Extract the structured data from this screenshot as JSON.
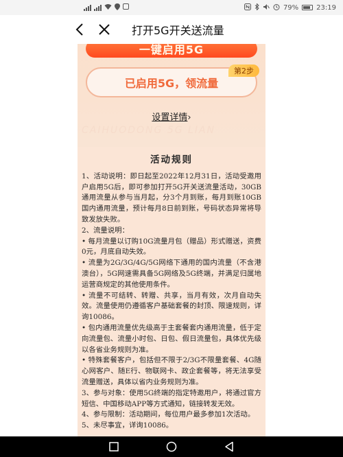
{
  "status_bar": {
    "left_icons": [
      "sim1-signal-icon",
      "sim2-signal-icon",
      "wifi-icon",
      "location-icon",
      "misc-icon"
    ],
    "right_icons": [
      "nfc-icon",
      "bluetooth-icon",
      "mute-icon",
      "alarm-icon"
    ],
    "battery": "79%",
    "time": "23:19"
  },
  "header": {
    "title": "打开5G开关送流量"
  },
  "promo": {
    "enable_label": "一键启用5G",
    "enabled_label": "已启用5G，领流量",
    "step_badge": "第2步",
    "settings_link": "设置详情",
    "settings_arrow": "›",
    "watermark": "CAIHUODONG 5G LIAN"
  },
  "rules": {
    "title": "活动规则",
    "paragraphs": [
      "1、活动说明：即日起至2022年12月31日，活动受邀用户启用5G后，即可参加打开5G开关送流量活动，30GB通用流量从参与当月起，分3个月到账，每月到账10GB国内通用流量，预计每月8日前到账，号码状态异常将导致发放失败。",
      "2、流量说明：",
      "• 每月流量以订购10G流量月包（赠品）形式赠送，资费0元，月底自动失效。",
      "• 流量为2G/3G/4G/5G网络下通用的国内流量（不含港澳台），5G网速需具备5G网络及5G终端，并满足归属地运营商规定的其他使用条件。",
      "• 流量不可结转、转赠、共享，当月有效，次月自动失效。流量使用仍遵循客户基础套餐的封顶、限速规则，详询10086。",
      "• 包内通用流量优先级高于主套餐套内通用流量，低于定向流量包、流量小时包、日包、假日流量包，具体优先级以各省业务规则为准。",
      "• 特殊套餐客户，包括但不限于2/3G不限量套餐、4G随心网客户、随E行、物联网卡、政企套餐等，将无法享受流量赠送，具体以省内业务规则为准。",
      "3、参与对象：使用5G终端的指定特邀用户，将通过官方短信、中国移动APP等方式通知，链接转发无效。",
      "4、参与限制：活动期间，每位用户最多参加1次活动。",
      "5、未尽事宜，详询10086。"
    ]
  },
  "nav_bar": {
    "buttons": [
      "recent-apps-icon",
      "home-icon",
      "back-triangle-icon"
    ]
  }
}
